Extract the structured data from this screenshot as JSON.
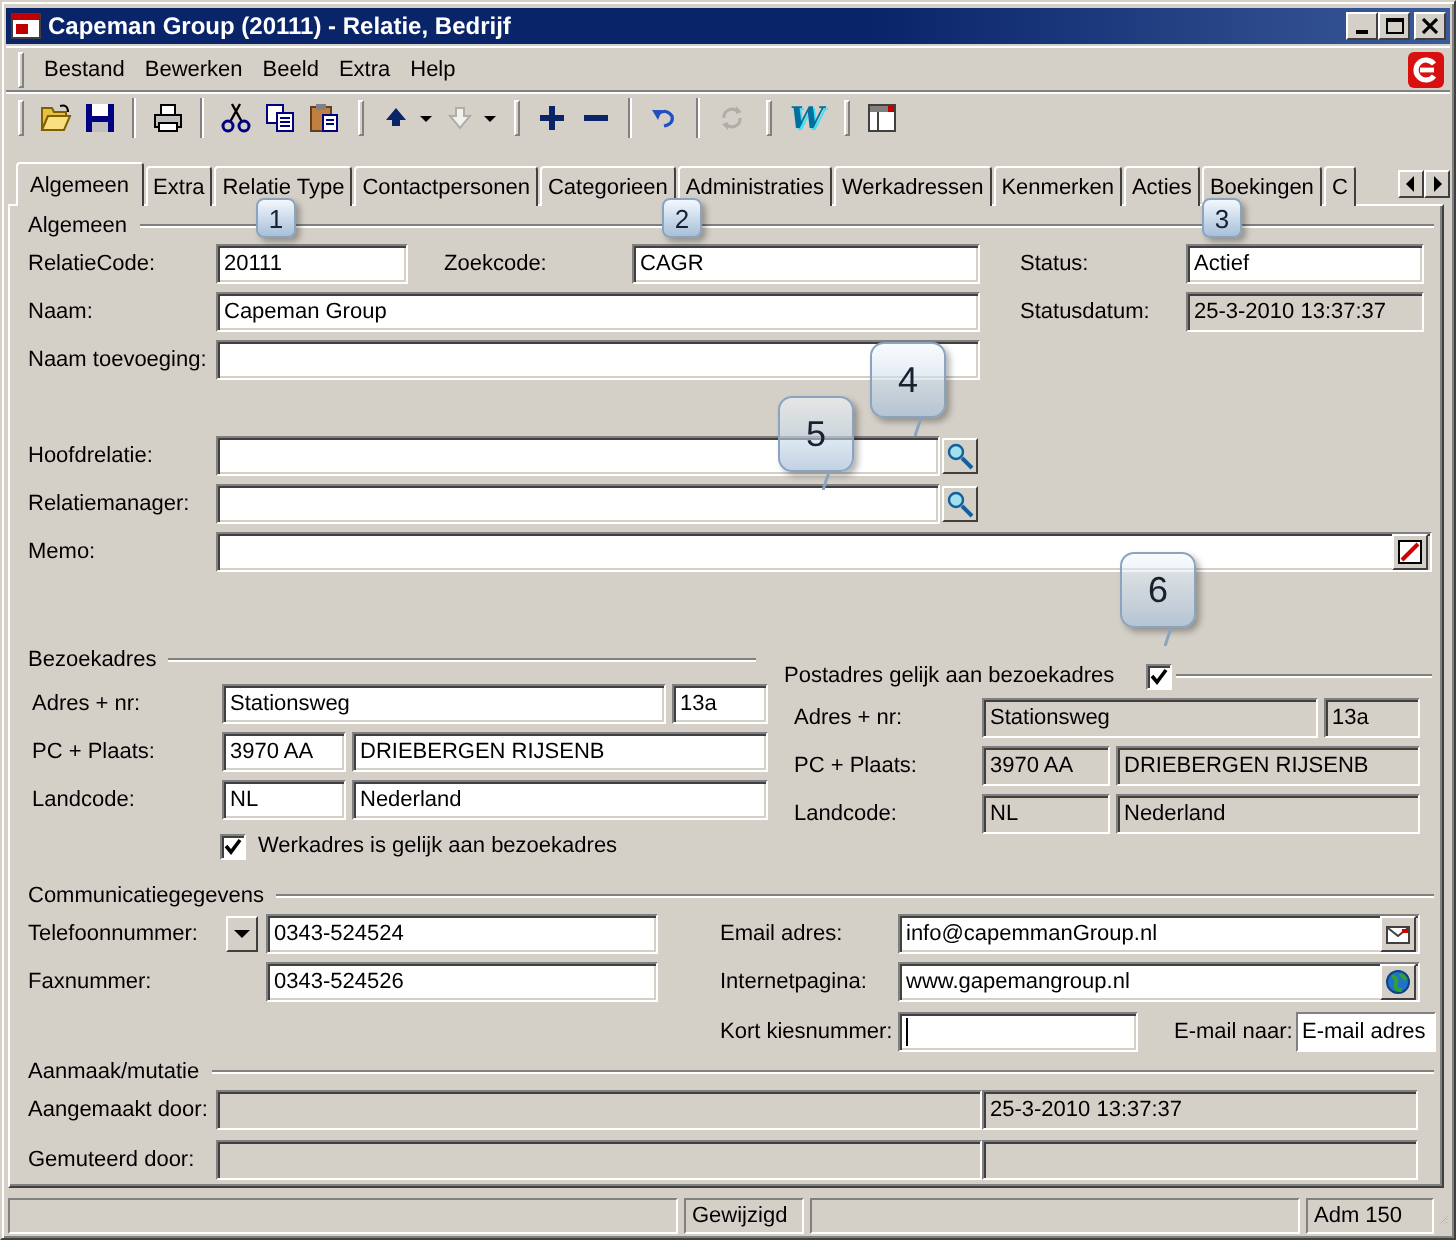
{
  "window": {
    "title": "Capeman Group (20111) - Relatie, Bedrijf"
  },
  "menu": [
    {
      "label": "Bestand"
    },
    {
      "label": "Bewerken"
    },
    {
      "label": "Beeld"
    },
    {
      "label": "Extra"
    },
    {
      "label": "Help"
    }
  ],
  "toolbar": [
    [
      [
        {
          "kind": "open",
          "disabled": false
        },
        {
          "kind": "save",
          "disabled": false
        }
      ],
      [
        {
          "kind": "print",
          "disabled": false
        }
      ],
      [
        {
          "kind": "cut",
          "disabled": false
        },
        {
          "kind": "copy",
          "disabled": false
        },
        {
          "kind": "paste",
          "disabled": false
        }
      ]
    ],
    [
      [
        {
          "kind": "up",
          "disabled": false
        },
        {
          "kind": "caret",
          "disabled": false
        },
        {
          "kind": "down",
          "disabled": true
        },
        {
          "kind": "caret",
          "disabled": false
        }
      ]
    ],
    [
      [
        {
          "kind": "plus",
          "disabled": false
        },
        {
          "kind": "minus",
          "disabled": false
        }
      ],
      [
        {
          "kind": "undo",
          "disabled": false
        }
      ],
      [
        {
          "kind": "refresh",
          "disabled": true
        }
      ]
    ],
    [
      [
        {
          "kind": "text",
          "text": "W",
          "disabled": false
        }
      ]
    ],
    [
      [
        {
          "kind": "window",
          "disabled": false
        }
      ]
    ]
  ],
  "tabs": [
    {
      "label": "Algemeen",
      "selected": true
    },
    {
      "label": "Extra",
      "selected": false
    },
    {
      "label": "Relatie Type",
      "selected": false
    },
    {
      "label": "Contactpersonen",
      "selected": false
    },
    {
      "label": "Categorieen",
      "selected": false
    },
    {
      "label": "Administraties",
      "selected": false
    },
    {
      "label": "Werkadressen",
      "selected": false
    },
    {
      "label": "Kenmerken",
      "selected": false
    },
    {
      "label": "Acties",
      "selected": false
    },
    {
      "label": "Boekingen",
      "selected": false
    },
    {
      "label": "C",
      "selected": false
    }
  ],
  "callouts": [
    {
      "number": "1"
    },
    {
      "number": "2"
    },
    {
      "number": "3"
    },
    {
      "number": "4"
    },
    {
      "number": "5"
    },
    {
      "number": "6"
    }
  ],
  "general": {
    "title": "Algemeen",
    "relation_code": {
      "label": "RelatieCode:",
      "value": "20111"
    },
    "search_code": {
      "label": "Zoekcode:",
      "value": "CAGR"
    },
    "status": {
      "label": "Status:",
      "value": "Actief"
    },
    "name": {
      "label": "Naam:",
      "value": "Capeman Group"
    },
    "status_date": {
      "label": "Statusdatum:",
      "value": "25-3-2010 13:37:37",
      "readonly": true
    },
    "name_addition": {
      "label": "Naam toevoeging:"
    },
    "parent_relation": {
      "label": "Hoofdrelatie:"
    },
    "relation_manager": {
      "label": "Relatiemanager:"
    },
    "memo": {
      "label": "Memo:"
    }
  },
  "visit_address": {
    "title": "Bezoekadres",
    "readonly": false,
    "address": {
      "label": "Adres + nr:",
      "street": "Stationsweg",
      "number": "13a"
    },
    "postal": {
      "label": "PC + Plaats:",
      "code": "3970 AA",
      "city": "DRIEBERGEN RIJSENB"
    },
    "country": {
      "label": "Landcode:",
      "code": "NL",
      "name": "Nederland"
    },
    "work_same": {
      "label": "Werkadres is gelijk aan bezoekadres",
      "checked": true
    }
  },
  "postal_address": {
    "title": "Postadres gelijk aan bezoekadres",
    "checked": true,
    "readonly": true,
    "address": {
      "label": "Adres + nr:",
      "street": "Stationsweg",
      "number": "13a"
    },
    "postal": {
      "label": "PC + Plaats:",
      "code": "3970 AA",
      "city": "DRIEBERGEN RIJSENB"
    },
    "country": {
      "label": "Landcode:",
      "code": "NL",
      "name": "Nederland"
    }
  },
  "communication": {
    "title": "Communicatiegegevens",
    "phone": {
      "label": "Telefoonnummer:",
      "value": "0343-524524"
    },
    "fax": {
      "label": "Faxnummer:",
      "value": "0343-524526"
    },
    "email": {
      "label": "Email adres:",
      "value": "info@capemmanGroup.nl"
    },
    "website": {
      "label": "Internetpagina:",
      "value": "www.gapemangroup.nl"
    },
    "speed_dial": {
      "label": "Kort kiesnummer:",
      "focused": true
    },
    "email_to": {
      "label": "E-mail naar:",
      "value": "E-mail adres"
    }
  },
  "audit": {
    "title": "Aanmaak/mutatie",
    "readonly": true,
    "created": {
      "label": "Aangemaakt door:",
      "date": "25-3-2010 13:37:37"
    },
    "modified": {
      "label": "Gemuteerd door:"
    }
  },
  "status_bar": {
    "state": "Gewijzigd",
    "administration": "Adm 150"
  }
}
